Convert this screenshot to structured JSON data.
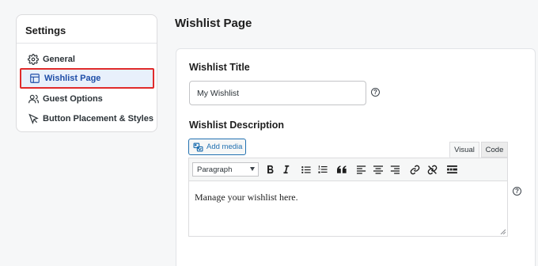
{
  "sidebar": {
    "title": "Settings",
    "items": [
      {
        "label": "General",
        "icon": "gear-icon"
      },
      {
        "label": "Wishlist Page",
        "icon": "layout-icon",
        "active": true
      },
      {
        "label": "Guest Options",
        "icon": "users-icon"
      },
      {
        "label": "Button Placement & Styles",
        "icon": "cursor-icon"
      }
    ]
  },
  "main": {
    "page_title": "Wishlist Page",
    "wishlist_title": {
      "label": "Wishlist Title",
      "value": "My Wishlist",
      "help_icon": "question-icon"
    },
    "wishlist_description": {
      "label": "Wishlist Description",
      "add_media_label": "Add media",
      "tabs": [
        "Visual",
        "Code"
      ],
      "active_tab": "Visual",
      "format_select": "Paragraph",
      "toolbar_icons": [
        "bold-icon",
        "italic-icon",
        "bullet-list-icon",
        "numbered-list-icon",
        "blockquote-icon",
        "align-left-icon",
        "align-center-icon",
        "align-right-icon",
        "link-icon",
        "unlink-icon",
        "toolbar-toggle-icon"
      ],
      "content": "Manage your wishlist here.",
      "help_icon": "question-icon"
    }
  },
  "colors": {
    "accent": "#2271b1",
    "active_nav_bg": "#e8f0fb",
    "active_nav_text": "#1f4ea8",
    "highlight_border": "#e02b2b"
  }
}
